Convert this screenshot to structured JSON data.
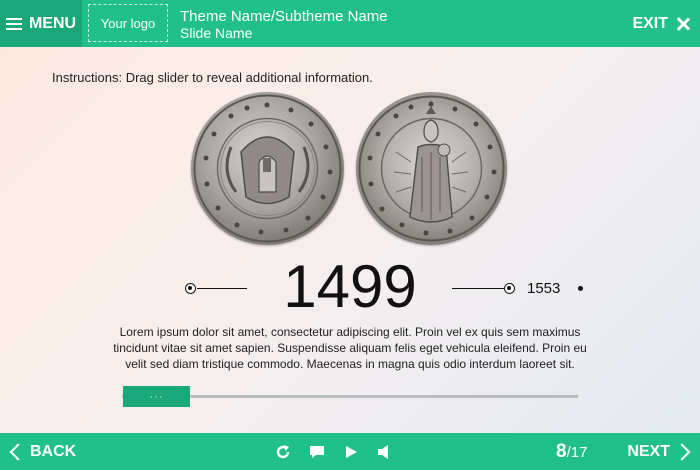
{
  "header": {
    "menu_label": "MENU",
    "logo_text": "Your logo",
    "theme_title": "Theme Name/Subtheme Name",
    "slide_name": "Slide Name",
    "exit_label": "EXIT"
  },
  "content": {
    "instructions": "Instructions: Drag slider to reveal additional information.",
    "current_year": "1499",
    "next_year": "1553",
    "body_text": "Lorem ipsum dolor sit amet, consectetur adipiscing elit. Proin vel ex quis sem maximus tincidunt vitae sit amet sapien. Suspendisse aliquam felis eget vehicula eleifend. Proin eu velit sed diam tristique commodo. Maecenas in magna quis odio interdum laoreet sit.",
    "slider_thumb_label": "···",
    "coin_left_legend": "1499 MONETA BASILIENSIS",
    "coin_right_legend": "AVE MARIA GRACIA PLENA"
  },
  "footer": {
    "back_label": "BACK",
    "next_label": "NEXT",
    "page_current": "8",
    "page_total": "/17",
    "icons": [
      "replay-icon",
      "comment-icon",
      "play-icon",
      "volume-icon"
    ]
  },
  "colors": {
    "accent": "#21c08b",
    "accent_dark": "#1aa77a"
  }
}
